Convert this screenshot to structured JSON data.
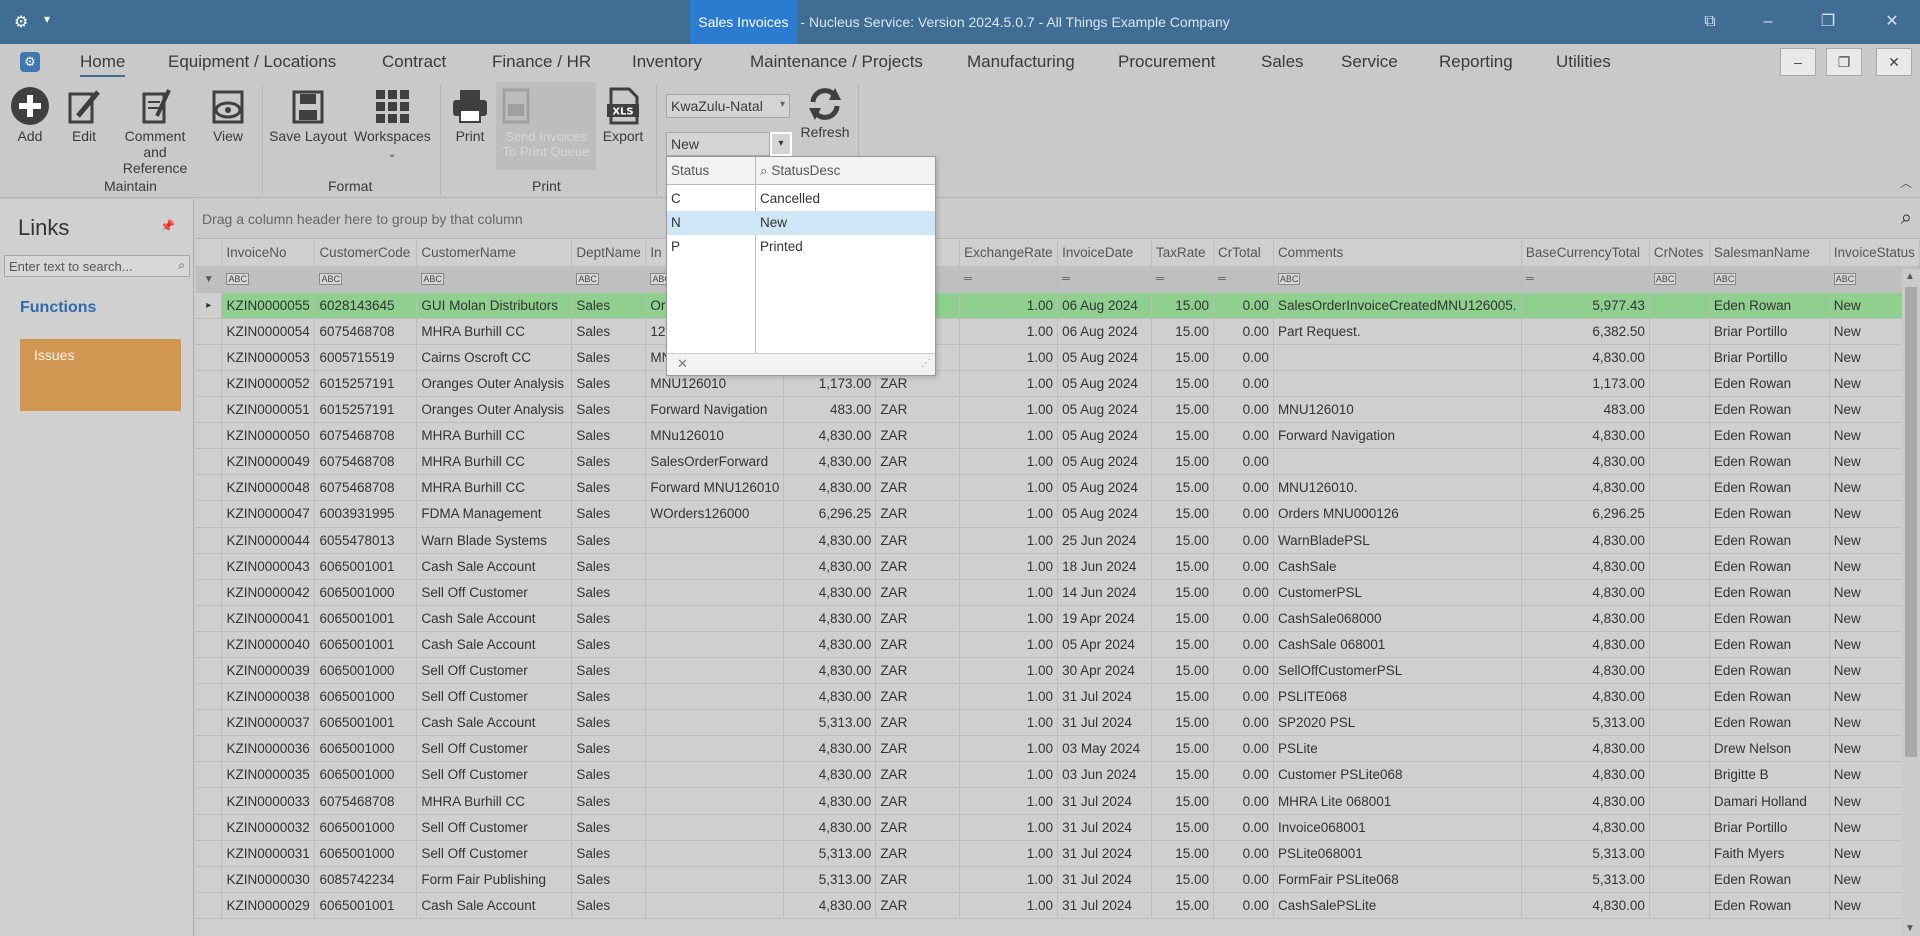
{
  "window": {
    "doc_title": "Sales Invoices",
    "app_title": " - Nucleus Service: Version 2024.5.0.7 - All Things Example Company"
  },
  "menu": [
    "Home",
    "Equipment / Locations",
    "Contract",
    "Finance / HR",
    "Inventory",
    "Maintenance / Projects",
    "Manufacturing",
    "Procurement",
    "Sales",
    "Service",
    "Reporting",
    "Utilities"
  ],
  "ribbon": {
    "maintain": {
      "label": "Maintain",
      "add": "Add",
      "edit": "Edit",
      "comment1": "Comment and",
      "comment2": "Reference",
      "view": "View"
    },
    "format": {
      "label": "Format",
      "save_layout": "Save Layout",
      "workspaces": "Workspaces"
    },
    "print": {
      "label": "Print",
      "print": "Print",
      "send1": "Send Invoices",
      "send2": "To Print Queue",
      "export": "Export",
      "xls": "XLS"
    },
    "filters": {
      "region": "KwaZulu-Natal",
      "status": "New",
      "refresh": "Refresh"
    }
  },
  "links": {
    "title": "Links",
    "search_placeholder": "Enter text to search...",
    "functions": "Functions",
    "tile": "Issues"
  },
  "grid": {
    "group_hint": "Drag a column header here to group by that column",
    "columns": [
      "InvoiceNo",
      "CustomerCode",
      "CustomerName",
      "DeptName",
      "In",
      "",
      "",
      "ExchangeRate",
      "InvoiceDate",
      "TaxRate",
      "CrTotal",
      "Comments",
      "BaseCurrencyTotal",
      "CrNotes",
      "SalesmanName",
      "InvoiceStatus"
    ],
    "rows": [
      [
        "KZIN0000055",
        "6028143645",
        "GUI Molan Distributors",
        "Sales",
        "Or",
        "",
        "",
        "1.00",
        "06 Aug 2024",
        "15.00",
        "0.00",
        "SalesOrderInvoiceCreatedMNU126005.",
        "5,977.43",
        "",
        "Eden Rowan",
        "New"
      ],
      [
        "KZIN0000054",
        "6075468708",
        "MHRA Burhill CC",
        "Sales",
        "12",
        "",
        "",
        "1.00",
        "06 Aug 2024",
        "15.00",
        "0.00",
        "Part Request.",
        "6,382.50",
        "",
        "Briar Portillo",
        "New"
      ],
      [
        "KZIN0000053",
        "6005715519",
        "Cairns Oscroft CC",
        "Sales",
        "MN",
        "",
        "",
        "1.00",
        "05 Aug 2024",
        "15.00",
        "0.00",
        "",
        "4,830.00",
        "",
        "Briar Portillo",
        "New"
      ],
      [
        "KZIN0000052",
        "6015257191",
        "Oranges Outer Analysis",
        "Sales",
        "MNU126010",
        "1,173.00",
        "ZAR",
        "1.00",
        "05 Aug 2024",
        "15.00",
        "0.00",
        "",
        "1,173.00",
        "",
        "Eden Rowan",
        "New"
      ],
      [
        "KZIN0000051",
        "6015257191",
        "Oranges Outer Analysis",
        "Sales",
        "Forward Navigation",
        "483.00",
        "ZAR",
        "1.00",
        "05 Aug 2024",
        "15.00",
        "0.00",
        "MNU126010",
        "483.00",
        "",
        "Eden Rowan",
        "New"
      ],
      [
        "KZIN0000050",
        "6075468708",
        "MHRA Burhill CC",
        "Sales",
        "MNu126010",
        "4,830.00",
        "ZAR",
        "1.00",
        "05 Aug 2024",
        "15.00",
        "0.00",
        "Forward Navigation",
        "4,830.00",
        "",
        "Eden Rowan",
        "New"
      ],
      [
        "KZIN0000049",
        "6075468708",
        "MHRA Burhill CC",
        "Sales",
        "SalesOrderForward",
        "4,830.00",
        "ZAR",
        "1.00",
        "05 Aug 2024",
        "15.00",
        "0.00",
        "",
        "4,830.00",
        "",
        "Eden Rowan",
        "New"
      ],
      [
        "KZIN0000048",
        "6075468708",
        "MHRA Burhill CC",
        "Sales",
        "Forward MNU126010",
        "4,830.00",
        "ZAR",
        "1.00",
        "05 Aug 2024",
        "15.00",
        "0.00",
        "MNU126010.",
        "4,830.00",
        "",
        "Eden Rowan",
        "New"
      ],
      [
        "KZIN0000047",
        "6003931995",
        "FDMA Management",
        "Sales",
        "WOrders126000",
        "6,296.25",
        "ZAR",
        "1.00",
        "05 Aug 2024",
        "15.00",
        "0.00",
        "Orders MNU000126",
        "6,296.25",
        "",
        "Eden Rowan",
        "New"
      ],
      [
        "KZIN0000044",
        "6055478013",
        "Warn Blade Systems",
        "Sales",
        "",
        "4,830.00",
        "ZAR",
        "1.00",
        "25 Jun 2024",
        "15.00",
        "0.00",
        "WarnBladePSL",
        "4,830.00",
        "",
        "Eden Rowan",
        "New"
      ],
      [
        "KZIN0000043",
        "6065001001",
        "Cash Sale Account",
        "Sales",
        "",
        "4,830.00",
        "ZAR",
        "1.00",
        "18 Jun 2024",
        "15.00",
        "0.00",
        "CashSale",
        "4,830.00",
        "",
        "Eden Rowan",
        "New"
      ],
      [
        "KZIN0000042",
        "6065001000",
        "Sell Off Customer",
        "Sales",
        "",
        "4,830.00",
        "ZAR",
        "1.00",
        "14 Jun 2024",
        "15.00",
        "0.00",
        "CustomerPSL",
        "4,830.00",
        "",
        "Eden Rowan",
        "New"
      ],
      [
        "KZIN0000041",
        "6065001001",
        "Cash Sale Account",
        "Sales",
        "",
        "4,830.00",
        "ZAR",
        "1.00",
        "19 Apr 2024",
        "15.00",
        "0.00",
        "CashSale068000",
        "4,830.00",
        "",
        "Eden Rowan",
        "New"
      ],
      [
        "KZIN0000040",
        "6065001001",
        "Cash Sale Account",
        "Sales",
        "",
        "4,830.00",
        "ZAR",
        "1.00",
        "05 Apr 2024",
        "15.00",
        "0.00",
        "CashSale 068001",
        "4,830.00",
        "",
        "Eden Rowan",
        "New"
      ],
      [
        "KZIN0000039",
        "6065001000",
        "Sell Off Customer",
        "Sales",
        "",
        "4,830.00",
        "ZAR",
        "1.00",
        "30 Apr 2024",
        "15.00",
        "0.00",
        "SellOffCustomerPSL",
        "4,830.00",
        "",
        "Eden Rowan",
        "New"
      ],
      [
        "KZIN0000038",
        "6065001000",
        "Sell Off Customer",
        "Sales",
        "",
        "4,830.00",
        "ZAR",
        "1.00",
        "31 Jul 2024",
        "15.00",
        "0.00",
        "PSLITE068",
        "4,830.00",
        "",
        "Eden Rowan",
        "New"
      ],
      [
        "KZIN0000037",
        "6065001001",
        "Cash Sale Account",
        "Sales",
        "",
        "5,313.00",
        "ZAR",
        "1.00",
        "31 Jul 2024",
        "15.00",
        "0.00",
        "SP2020 PSL",
        "5,313.00",
        "",
        "Eden Rowan",
        "New"
      ],
      [
        "KZIN0000036",
        "6065001000",
        "Sell Off Customer",
        "Sales",
        "",
        "4,830.00",
        "ZAR",
        "1.00",
        "03 May 2024",
        "15.00",
        "0.00",
        "PSLite",
        "4,830.00",
        "",
        "Drew Nelson",
        "New"
      ],
      [
        "KZIN0000035",
        "6065001000",
        "Sell Off Customer",
        "Sales",
        "",
        "4,830.00",
        "ZAR",
        "1.00",
        "03 Jun 2024",
        "15.00",
        "0.00",
        "Customer PSLite068",
        "4,830.00",
        "",
        "Brigitte B",
        "New"
      ],
      [
        "KZIN0000033",
        "6075468708",
        "MHRA Burhill CC",
        "Sales",
        "",
        "4,830.00",
        "ZAR",
        "1.00",
        "31 Jul 2024",
        "15.00",
        "0.00",
        "MHRA Lite 068001",
        "4,830.00",
        "",
        "Damari Holland",
        "New"
      ],
      [
        "KZIN0000032",
        "6065001000",
        "Sell Off Customer",
        "Sales",
        "",
        "4,830.00",
        "ZAR",
        "1.00",
        "31 Jul 2024",
        "15.00",
        "0.00",
        "Invoice068001",
        "4,830.00",
        "",
        "Briar Portillo",
        "New"
      ],
      [
        "KZIN0000031",
        "6065001000",
        "Sell Off Customer",
        "Sales",
        "",
        "5,313.00",
        "ZAR",
        "1.00",
        "31 Jul 2024",
        "15.00",
        "0.00",
        "PSLite068001",
        "5,313.00",
        "",
        "Faith Myers",
        "New"
      ],
      [
        "KZIN0000030",
        "6085742234",
        "Form Fair Publishing",
        "Sales",
        "",
        "5,313.00",
        "ZAR",
        "1.00",
        "31 Jul 2024",
        "15.00",
        "0.00",
        "FormFair PSLite068",
        "5,313.00",
        "",
        "Eden Rowan",
        "New"
      ],
      [
        "KZIN0000029",
        "6065001001",
        "Cash Sale Account",
        "Sales",
        "",
        "4,830.00",
        "ZAR",
        "1.00",
        "31 Jul 2024",
        "15.00",
        "0.00",
        "CashSalePSLite",
        "4,830.00",
        "",
        "Eden Rowan",
        "New"
      ]
    ]
  },
  "status_popup": {
    "col1": "Status",
    "col2": "StatusDesc",
    "items": [
      {
        "code": "C",
        "desc": "Cancelled"
      },
      {
        "code": "N",
        "desc": "New"
      },
      {
        "code": "P",
        "desc": "Printed"
      }
    ]
  }
}
